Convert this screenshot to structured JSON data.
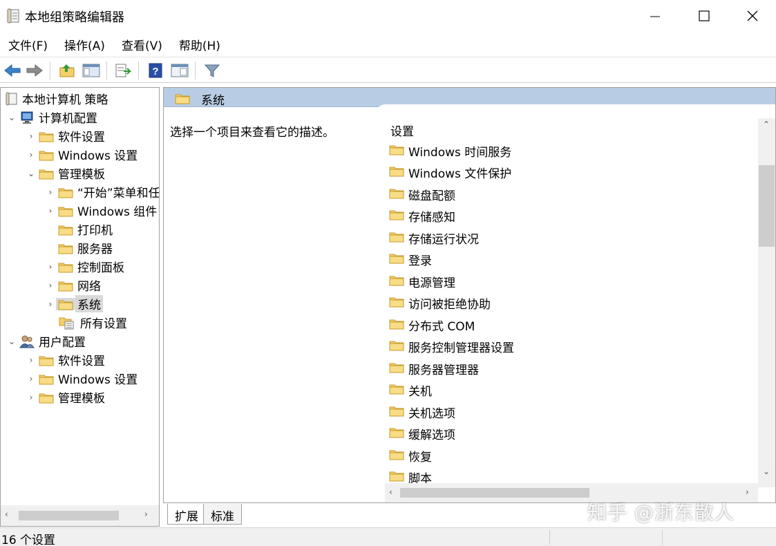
{
  "window": {
    "title": "本地组策略编辑器",
    "minimize_icon": "minimize-icon",
    "maximize_icon": "maximize-icon",
    "close_icon": "close-icon"
  },
  "menu": [
    "文件(F)",
    "操作(A)",
    "查看(V)",
    "帮助(H)"
  ],
  "toolbar": {
    "buttons": [
      "back-arrow-icon",
      "forward-arrow-icon",
      "up-folder-icon",
      "show-hide-tree-icon",
      "export-list-icon",
      "help-icon",
      "extended-view-icon",
      "filter-icon"
    ]
  },
  "tree": {
    "root": "本地计算机 策略",
    "computer_config": "计算机配置",
    "cc_software": "软件设置",
    "cc_windows": "Windows 设置",
    "cc_admin": "管理模板",
    "cc_admin_start": "“开始”菜单和任务栏",
    "cc_admin_wincomp": "Windows 组件",
    "cc_admin_printer": "打印机",
    "cc_admin_server": "服务器",
    "cc_admin_control": "控制面板",
    "cc_admin_network": "网络",
    "cc_admin_system": "系统",
    "cc_admin_all": "所有设置",
    "user_config": "用户配置",
    "uc_software": "软件设置",
    "uc_windows": "Windows 设置",
    "uc_admin": "管理模板"
  },
  "right_pane": {
    "header_title": "系统",
    "description": "选择一个项目来查看它的描述。",
    "column_header": "设置",
    "items": [
      "Windows 时间服务",
      "Windows 文件保护",
      "磁盘配额",
      "存储感知",
      "存储运行状况",
      "登录",
      "电源管理",
      "访问被拒绝协助",
      "分布式 COM",
      "服务控制管理器设置",
      "服务器管理器",
      "关机",
      "关机选项",
      "缓解选项",
      "恢复",
      "脚本"
    ]
  },
  "tabs": {
    "expanded": "扩展",
    "standard": "标准"
  },
  "status": {
    "text": "16 个设置"
  },
  "watermark": "知乎 @浙东散人",
  "colors": {
    "header_bg": "#b8cde3",
    "folder": "#f3cf6b",
    "selected": "#d9d9d9"
  }
}
